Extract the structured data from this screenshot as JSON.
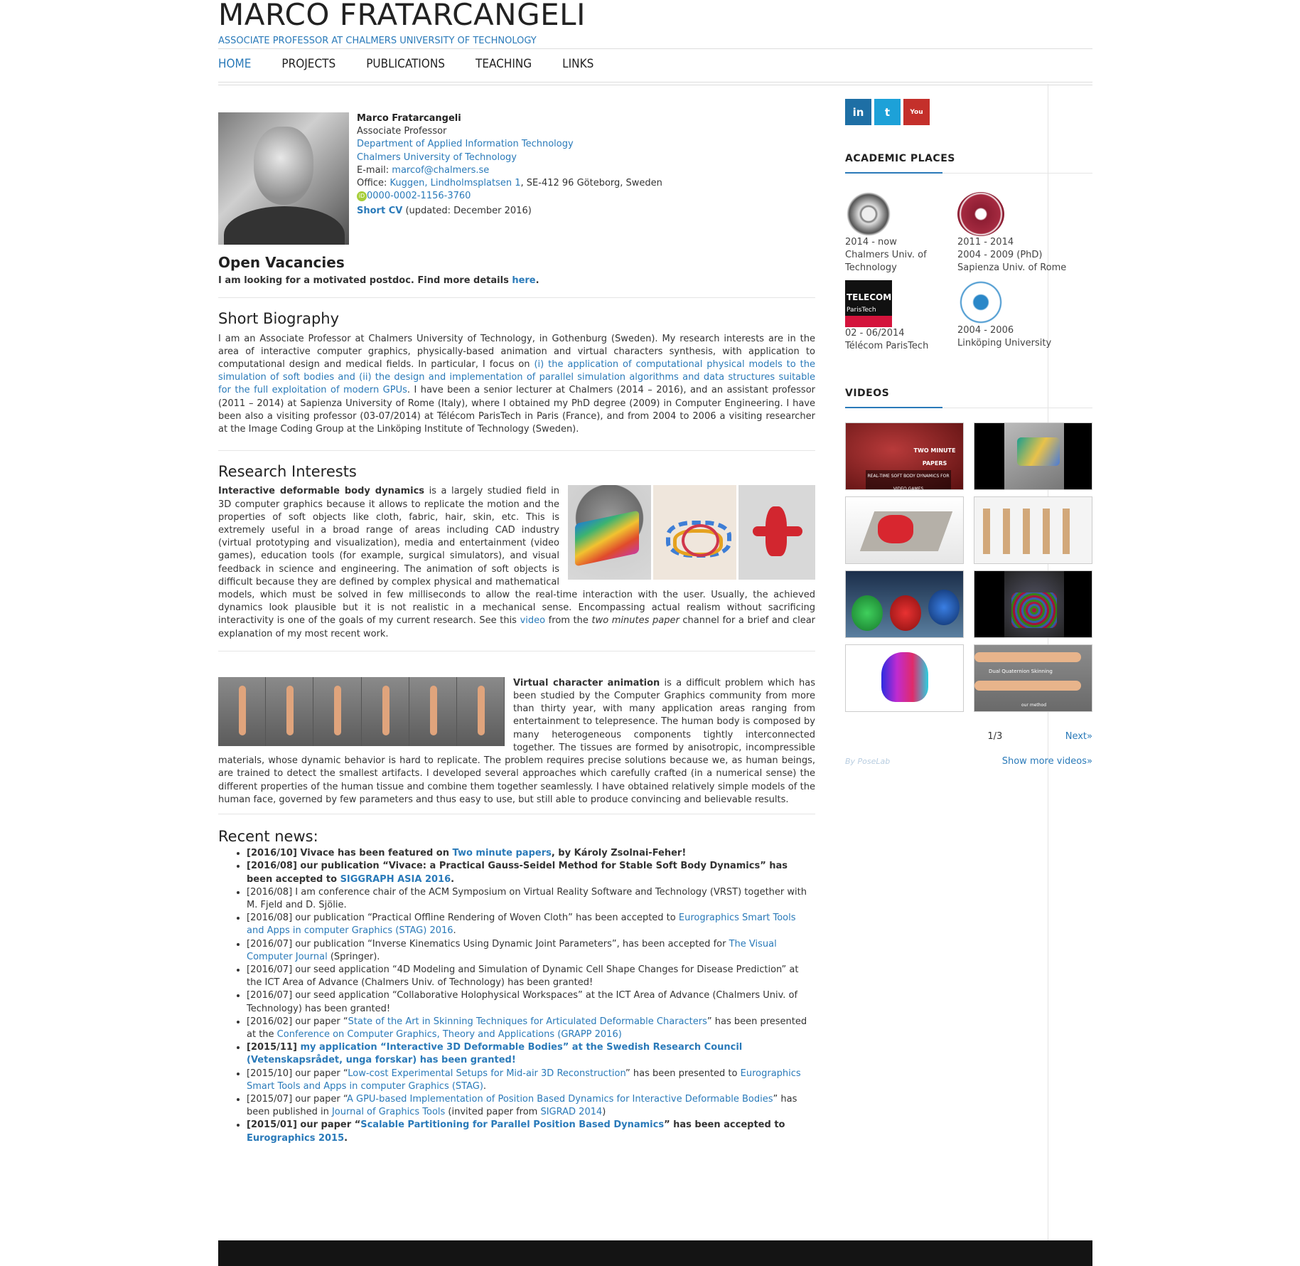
{
  "header": {
    "title": "MARCO FRATARCANGELI",
    "subtitle": "ASSOCIATE PROFESSOR AT CHALMERS UNIVERSITY OF TECHNOLOGY",
    "nav": [
      "HOME",
      "PROJECTS",
      "PUBLICATIONS",
      "TEACHING",
      "LINKS"
    ]
  },
  "profile": {
    "name": "Marco Fratarcangeli",
    "position": "Associate Professor",
    "department": "Department of Applied Information Technology",
    "university": "Chalmers University of Technology",
    "email_label": "E-mail: ",
    "email": "marcof@chalmers.se",
    "office_label": "Office: ",
    "office_link": "Kuggen, Lindholmsplatsen 1",
    "office_rest": ", SE-412 96 Göteborg, Sweden",
    "orcid": "0000-0002-1156-3760",
    "cv_link": "Short CV",
    "cv_note": " (updated: December 2016)"
  },
  "vacancies": {
    "title": "Open Vacancies",
    "text": "I am looking for a motivated postdoc. Find more details ",
    "link": "here",
    "end": "."
  },
  "bio": {
    "title": "Short Biography",
    "p1": "I am an Associate Professor at Chalmers University of Technology, in Gothenburg (Sweden). My research interests are in the area of interactive computer graphics, physically-based animation and virtual characters synthesis, with application to computational design and medical fields. In particular, I focus on ",
    "link": "(i) the application of computational physical models to the simulation of soft bodies and (ii) the design and implementation of parallel simulation algorithms and data structures suitable for the full exploitation of modern GPUs",
    "p2": ". I have been a senior lecturer at Chalmers (2014 – 2016), and an assistant professor (2011 – 2014) at Sapienza University of Rome (Italy), where I obtained my PhD degree (2009) in Computer Engineering. I have been also a visiting professor (03-07/2014) at Télécom ParisTech in Paris (France), and from 2004 to 2006 a visiting researcher at the Image Coding Group at the Linköping Institute of Technology (Sweden)."
  },
  "research": {
    "title": "Research Interests",
    "bold1": "Interactive deformable body dynamics",
    "text1": " is a largely studied field in 3D computer graphics because it allows to replicate the motion and the properties of soft objects like cloth, fabric, hair, skin, etc. This is extremely useful in a broad range of areas including CAD industry (virtual prototyping and visualization), media and entertainment (video games), education tools (for example, surgical simulators), and visual feedback in science and engineering. The animation of soft objects is difficult because they are defined by complex physical and mathematical models, which must be solved in few milliseconds to allow the real-time interaction with the user. Usually, the achieved dynamics look plausible but it is not realistic in a mechanical sense. Encompassing actual realism without sacrificing interactivity is one of the goals of my current research. See this ",
    "video_link": "video",
    "text1b": " from the ",
    "italic": "two minutes paper",
    "text1c": " channel for a brief and clear explanation of my most recent work.",
    "bold2": "Virtual character animation",
    "text2": " is a difficult problem which has been studied by the Computer Graphics community from more than thirty year, with many application areas ranging from entertainment to telepresence. The human body is composed by many heterogeneous components tightly interconnected together. The tissues are formed by anisotropic, incompressible materials, whose dynamic behavior is hard to replicate. The problem requires precise solutions because we, as human beings, are trained to detect the smallest artifacts. I developed several approaches which carefully crafted (in a numerical sense) the different properties of the human tissue and combine them together seamlessly. I have obtained relatively simple models of the human face, governed by few parameters and thus easy to use, but still able to produce convincing and believable results."
  },
  "news": {
    "title": "Recent news:",
    "items": [
      {
        "bold": true,
        "parts": [
          {
            "t": "[2016/10] Vivace has been featured on "
          },
          {
            "t": "Two minute papers",
            "link": true
          },
          {
            "t": ", by Károly Zsolnai-Feher!"
          }
        ]
      },
      {
        "bold": true,
        "parts": [
          {
            "t": "[2016/08] our publication “Vivace: a Practical Gauss-Seidel Method for Stable Soft Body Dynamics” has been accepted to "
          },
          {
            "t": "SIGGRAPH ASIA 2016",
            "link": true
          },
          {
            "t": "."
          }
        ]
      },
      {
        "bold": false,
        "parts": [
          {
            "t": "[2016/08] I am conference chair of the ACM Symposium on Virtual Reality Software and Technology (VRST) together with M. Fjeld and D. Sjölie."
          }
        ]
      },
      {
        "bold": false,
        "parts": [
          {
            "t": "[2016/08] our publication “Practical Offline Rendering of Woven Cloth” has been accepted to "
          },
          {
            "t": "Eurographics Smart Tools and Apps in computer Graphics (STAG) 2016",
            "link": true
          },
          {
            "t": "."
          }
        ]
      },
      {
        "bold": false,
        "parts": [
          {
            "t": "[2016/07] our publication “Inverse Kinematics Using Dynamic Joint Parameters”, has been accepted for "
          },
          {
            "t": "The Visual Computer Journal",
            "link": true
          },
          {
            "t": " (Springer)."
          }
        ]
      },
      {
        "bold": false,
        "parts": [
          {
            "t": "[2016/07] our seed application “4D Modeling and Simulation of Dynamic Cell Shape Changes for Disease Prediction” at the ICT Area of Advance (Chalmers Univ. of Technology) has been granted!"
          }
        ]
      },
      {
        "bold": false,
        "parts": [
          {
            "t": "[2016/07] our seed application “Collaborative Holophysical Workspaces” at the ICT Area of Advance (Chalmers Univ. of Technology) has been granted!"
          }
        ]
      },
      {
        "bold": false,
        "parts": [
          {
            "t": "[2016/02] our paper “"
          },
          {
            "t": "State of the Art in Skinning Techniques for Articulated Deformable Characters",
            "link": true
          },
          {
            "t": "” has been presented at the "
          },
          {
            "t": "Conference on Computer Graphics, Theory and Applications (GRAPP 2016)",
            "link": true
          }
        ]
      },
      {
        "bold": true,
        "parts": [
          {
            "t": "[2015/11] "
          },
          {
            "t": "my application “Interactive 3D Deformable Bodies” at the Swedish Research Council (Vetenskapsrådet, unga forskar) has been granted!",
            "link": true
          }
        ]
      },
      {
        "bold": false,
        "parts": [
          {
            "t": "[2015/10] our paper “"
          },
          {
            "t": "Low-cost Experimental Setups for Mid-air 3D Reconstruction",
            "link": true
          },
          {
            "t": "” has been presented to "
          },
          {
            "t": "Eurographics Smart Tools and Apps in computer Graphics (STAG)",
            "link": true
          },
          {
            "t": "."
          }
        ]
      },
      {
        "bold": false,
        "parts": [
          {
            "t": "[2015/07] our paper “"
          },
          {
            "t": "A GPU-based Implementation of Position Based Dynamics for Interactive Deformable Bodies",
            "link": true
          },
          {
            "t": "” has been published in "
          },
          {
            "t": "Journal of Graphics Tools",
            "link": true
          },
          {
            "t": " (invited paper from "
          },
          {
            "t": "SIGRAD 2014",
            "link": true
          },
          {
            "t": ")"
          }
        ]
      },
      {
        "bold": true,
        "parts": [
          {
            "t": "[2015/01] our paper “"
          },
          {
            "t": "Scalable Partitioning for Parallel Position Based Dynamics",
            "link": true
          },
          {
            "t": "” has been accepted to "
          },
          {
            "t": "Eurographics 2015",
            "link": true
          },
          {
            "t": "."
          }
        ]
      }
    ]
  },
  "sidebar": {
    "social": [
      {
        "icon": "linkedin-icon",
        "glyph": "in",
        "color": "#1e6fa5"
      },
      {
        "icon": "twitter-icon",
        "glyph": "t",
        "color": "#1da1d8"
      },
      {
        "icon": "youtube-icon",
        "glyph": "You",
        "color": "#c4302b"
      }
    ],
    "academic_title": "ACADEMIC PLACES",
    "places": [
      {
        "lines": [
          "2014 - now",
          "Chalmers Univ. of",
          "Technology"
        ],
        "logo": "chalmers-logo"
      },
      {
        "lines": [
          "2011 - 2014",
          "2004 - 2009 (PhD)",
          "Sapienza Univ. of Rome"
        ],
        "logo": "sapienza-logo"
      },
      {
        "lines": [
          "02 - 06/2014",
          "Télécom ParisTech"
        ],
        "logo": "telecom-logo",
        "logo_text": "TELECOM",
        "logo_sub": "ParisTech"
      },
      {
        "lines": [
          "2004 - 2006",
          "Linköping University"
        ],
        "logo": "linkoping-logo"
      }
    ],
    "videos_title": "VIDEOS",
    "videos": [
      {
        "name": "video-thumb-two-minute-papers",
        "caption": "TWO MINUTE PAPERS",
        "sub": "REAL-TIME SOFT BODY DYNAMICS FOR VIDEO GAMES"
      },
      {
        "name": "video-thumb-cloth-chair",
        "caption": "",
        "sub": ""
      },
      {
        "name": "video-thumb-cloth-table",
        "caption": "",
        "sub": ""
      },
      {
        "name": "video-thumb-skeletons",
        "caption": "",
        "sub": ""
      },
      {
        "name": "video-thumb-hair",
        "caption": "",
        "sub": ""
      },
      {
        "name": "video-thumb-rings",
        "caption": "",
        "sub": ""
      },
      {
        "name": "video-thumb-jelly",
        "caption": "",
        "sub": ""
      },
      {
        "name": "video-thumb-arm-skinning",
        "caption": "Dual Quaternion Skinning",
        "sub": "our method"
      }
    ],
    "pager": {
      "page": "1/3",
      "next": "Next»"
    },
    "by": "By PoseLab",
    "more": "Show more videos»"
  }
}
